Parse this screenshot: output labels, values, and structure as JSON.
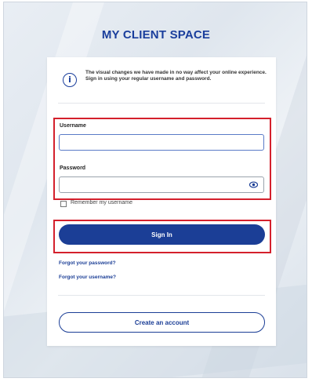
{
  "page": {
    "title": "MY CLIENT SPACE"
  },
  "notice": {
    "icon": "info-icon",
    "text": "The visual changes we have made in no way affect your online experience. Sign in using your regular username and password."
  },
  "form": {
    "username": {
      "label": "Username",
      "value": "",
      "placeholder": ""
    },
    "password": {
      "label": "Password",
      "value": "",
      "placeholder": "",
      "toggle_icon": "eye-icon"
    },
    "remember": {
      "label": "Remember my username",
      "checked": false
    },
    "signin_label": "Sign In"
  },
  "links": {
    "forgot_password": "Forgot your password?",
    "forgot_username": "Forgot your username?"
  },
  "create_account_label": "Create an account",
  "colors": {
    "brand": "#1b3e96",
    "highlight": "#d4202c"
  }
}
